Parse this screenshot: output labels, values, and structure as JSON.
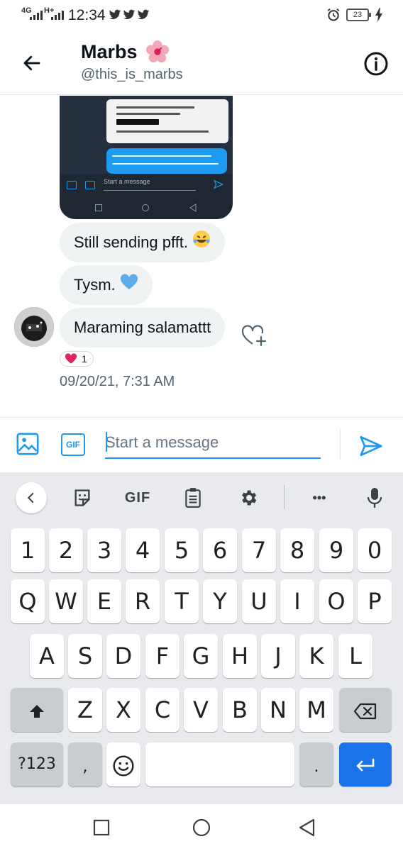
{
  "status_bar": {
    "network": "4G",
    "network2": "H+",
    "time": "12:34",
    "battery": "23",
    "icons": [
      "twitter-icon",
      "twitter-icon",
      "twitter-icon",
      "alarm-icon",
      "charging-icon"
    ]
  },
  "header": {
    "name": "Marbs",
    "handle": "@this_is_marbs",
    "back_icon": "arrow-left-icon",
    "info_icon": "info-icon"
  },
  "conversation": {
    "shared_screenshot": {
      "card_text": "P50.00 prepaid credits was loaded to ur mobile# Trace No: 677905082 09/18/2021 09:47PM.",
      "reply_text": "I received it already. Didn't know na di pala nagsend last Saturday yung",
      "input_placeholder": "Start a message"
    },
    "messages": [
      {
        "text": "Still sending pfft.",
        "emoji": "🤣"
      },
      {
        "text": "Tysm.",
        "emoji": "💙"
      },
      {
        "text": "Maraming salamattt",
        "emoji": ""
      }
    ],
    "reaction": {
      "emoji": "❤️",
      "count": "1"
    },
    "timestamp": "09/20/21, 7:31 AM"
  },
  "composer": {
    "placeholder": "Start a message",
    "gif_label": "GIF"
  },
  "keyboard": {
    "toolbar": {
      "gif_label": "GIF",
      "more_label": "•••"
    },
    "row_numbers": [
      "1",
      "2",
      "3",
      "4",
      "5",
      "6",
      "7",
      "8",
      "9",
      "0"
    ],
    "row1": [
      "Q",
      "W",
      "E",
      "R",
      "T",
      "Y",
      "U",
      "I",
      "O",
      "P"
    ],
    "row2": [
      "A",
      "S",
      "D",
      "F",
      "G",
      "H",
      "J",
      "K",
      "L"
    ],
    "row3": [
      "Z",
      "X",
      "C",
      "V",
      "B",
      "N",
      "M"
    ],
    "symbols_label": "?123",
    "comma_label": ",",
    "period_label": "."
  },
  "colors": {
    "accent": "#1d9bf0",
    "bubble": "#eff3f4",
    "keyboard_bg": "#e8eaed",
    "enter_key": "#1a73e8"
  }
}
